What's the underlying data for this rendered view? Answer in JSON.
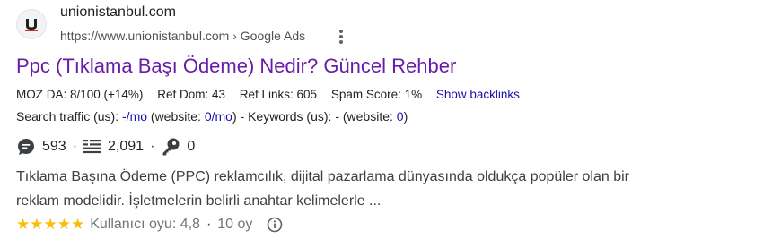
{
  "site": {
    "name": "unionistanbul.com",
    "url": "https://www.unionistanbul.com",
    "breadcrumb_sep": "›",
    "ads_label": "Google Ads",
    "favicon_letter": "U"
  },
  "result": {
    "title": "Ppc (Tıklama Başı Ödeme) Nedir? Güncel Rehber"
  },
  "moz": {
    "da": "MOZ DA: 8/100 (+14%)",
    "ref_dom": "Ref Dom: 43",
    "ref_links": "Ref Links: 605",
    "spam": "Spam Score: 1%",
    "backlinks_link": "Show backlinks"
  },
  "traffic": {
    "label": "Search traffic (us): ",
    "value": "-/mo",
    "website_open": " (website: ",
    "website_value": "0/mo",
    "website_close": ")",
    "kw_label": " - Keywords (us): - (website: ",
    "kw_value": "0",
    "kw_close": ")"
  },
  "stats": {
    "comments": "593",
    "pages": "2,091",
    "keys": "0",
    "sep": "·"
  },
  "snippet": {
    "line1": "Tıklama Başına Ödeme (PPC) reklamcılık, dijital pazarlama dünyasında oldukça popüler olan bir",
    "line2": "reklam modelidir. İşletmelerin belirli anahtar kelimelerle ..."
  },
  "rating": {
    "stars": "★★★★★",
    "value": 4.8,
    "text": "Kullanıcı oyu: 4,8",
    "sep": "·",
    "votes": "10 oy"
  },
  "icons": {
    "favicon": "unionistanbul-logo-icon",
    "more": "kebab-menu-icon",
    "comments": "comment-bubble-icon",
    "pages": "list-lines-icon",
    "keys": "key-icon",
    "info": "info-circle-icon"
  },
  "colors": {
    "title": "#681da8",
    "link": "#1a0dab",
    "star": "#fbbc04",
    "muted": "#4d5156"
  }
}
